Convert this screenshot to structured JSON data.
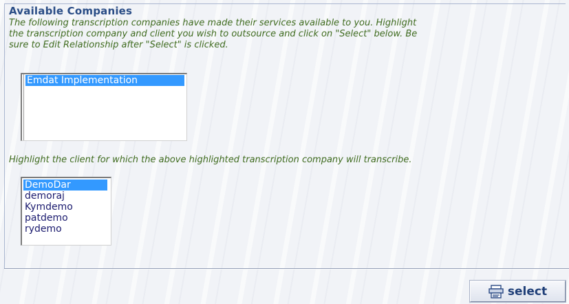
{
  "section": {
    "title": "Available Companies",
    "intro": "The following transcription companies have made their services available to you. Highlight\nthe transcription company and client you wish to outsource and click on \"Select\" below. Be\nsure to Edit Relationship after \"Select\" is clicked."
  },
  "companies": {
    "options": [
      "Emdat Implementation"
    ],
    "selected": "Emdat Implementation"
  },
  "clients": {
    "hint": "Highlight the client for which the above highlighted transcription company will transcribe.",
    "options": [
      "DemoDar",
      "demoraj",
      "Kymdemo",
      "patdemo",
      "rydemo"
    ],
    "selected": "DemoDar"
  },
  "actions": {
    "select_label": "select",
    "select_icon": "list-icon"
  },
  "colors": {
    "title": "#2a4d86",
    "instruction_text": "#3f6b1f",
    "selection_highlight": "#3399ff"
  }
}
